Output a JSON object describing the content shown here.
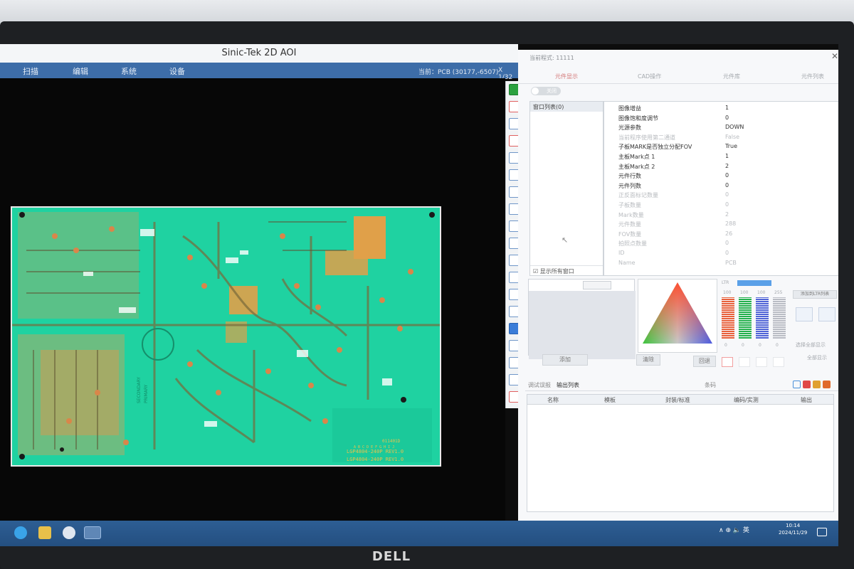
{
  "app": {
    "title": "Sinic-Tek 2D AOI",
    "menu": [
      "扫描",
      "编辑",
      "系统",
      "设备"
    ],
    "status": "当前：PCB (30177,-6507)",
    "zoom": "X 1/32"
  },
  "pcb": {
    "marking1": "SECONDARY",
    "marking2": "PRIMARY",
    "code": "011401D",
    "label1": "LGP4804-240P REV1.0",
    "label2": "LGP4804-240P REV1.0",
    "serial": "A B C D E F G H I J"
  },
  "right_panel": {
    "title": "当前程式: 11111",
    "tabs": [
      "元件显示",
      "CAD操作",
      "元件库",
      "元件列表"
    ],
    "toggle_label": "关闭",
    "window_list": {
      "header": "窗口列表(0)",
      "show_all": "显示所有窗口"
    },
    "properties": [
      {
        "key": "图像增益",
        "value": "1",
        "dim": false
      },
      {
        "key": "图像饱和度调节",
        "value": "0",
        "dim": false
      },
      {
        "key": "光源参数",
        "value": "DOWN",
        "dim": false
      },
      {
        "key": "当前程序使用第二通道",
        "value": "False",
        "dim": true
      },
      {
        "key": "子板MARK是否独立分配FOV",
        "value": "True",
        "dim": false
      },
      {
        "key": "主板Mark点 1",
        "value": "1",
        "dim": false
      },
      {
        "key": "主板Mark点 2",
        "value": "2",
        "dim": false
      },
      {
        "key": "元件行数",
        "value": "0",
        "dim": false
      },
      {
        "key": "元件列数",
        "value": "0",
        "dim": false
      },
      {
        "key": "正反面标记数量",
        "value": "0",
        "dim": true
      },
      {
        "key": "子板数量",
        "value": "0",
        "dim": true
      },
      {
        "key": "Mark数量",
        "value": "2",
        "dim": true
      },
      {
        "key": "元件数量",
        "value": "288",
        "dim": true
      },
      {
        "key": "FOV数量",
        "value": "26",
        "dim": true
      },
      {
        "key": "拍照点数量",
        "value": "0",
        "dim": true
      },
      {
        "key": "ID",
        "value": "0",
        "dim": true
      },
      {
        "key": "Name",
        "value": "PCB",
        "dim": true
      }
    ],
    "buttons": {
      "add": "添加",
      "clear": "清除",
      "back": "回退"
    },
    "histogram": {
      "label_top": "LTR",
      "add_list_btn": "添加到LTR列表",
      "scale": [
        "100",
        "100",
        "100",
        "255"
      ],
      "bottom": [
        "0",
        "0",
        "0",
        "0"
      ],
      "option1": "选择全部显示",
      "option2": "全部显示",
      "colors": {
        "red": "#e8603a",
        "green": "#22b04c",
        "blue": "#4f63d6",
        "gray": "#b9bcc4"
      }
    },
    "log": {
      "tabs": [
        "调试误报",
        "输出列表"
      ],
      "center_label": "条码",
      "columns": [
        "名称",
        "模板",
        "封装/标准",
        "编码/实测",
        "输出"
      ]
    }
  },
  "taskbar": {
    "tray": "∧ ⊕ 🔈 英",
    "time": "10:14",
    "date": "2024/11/29"
  },
  "monitor_brand": "DELL"
}
